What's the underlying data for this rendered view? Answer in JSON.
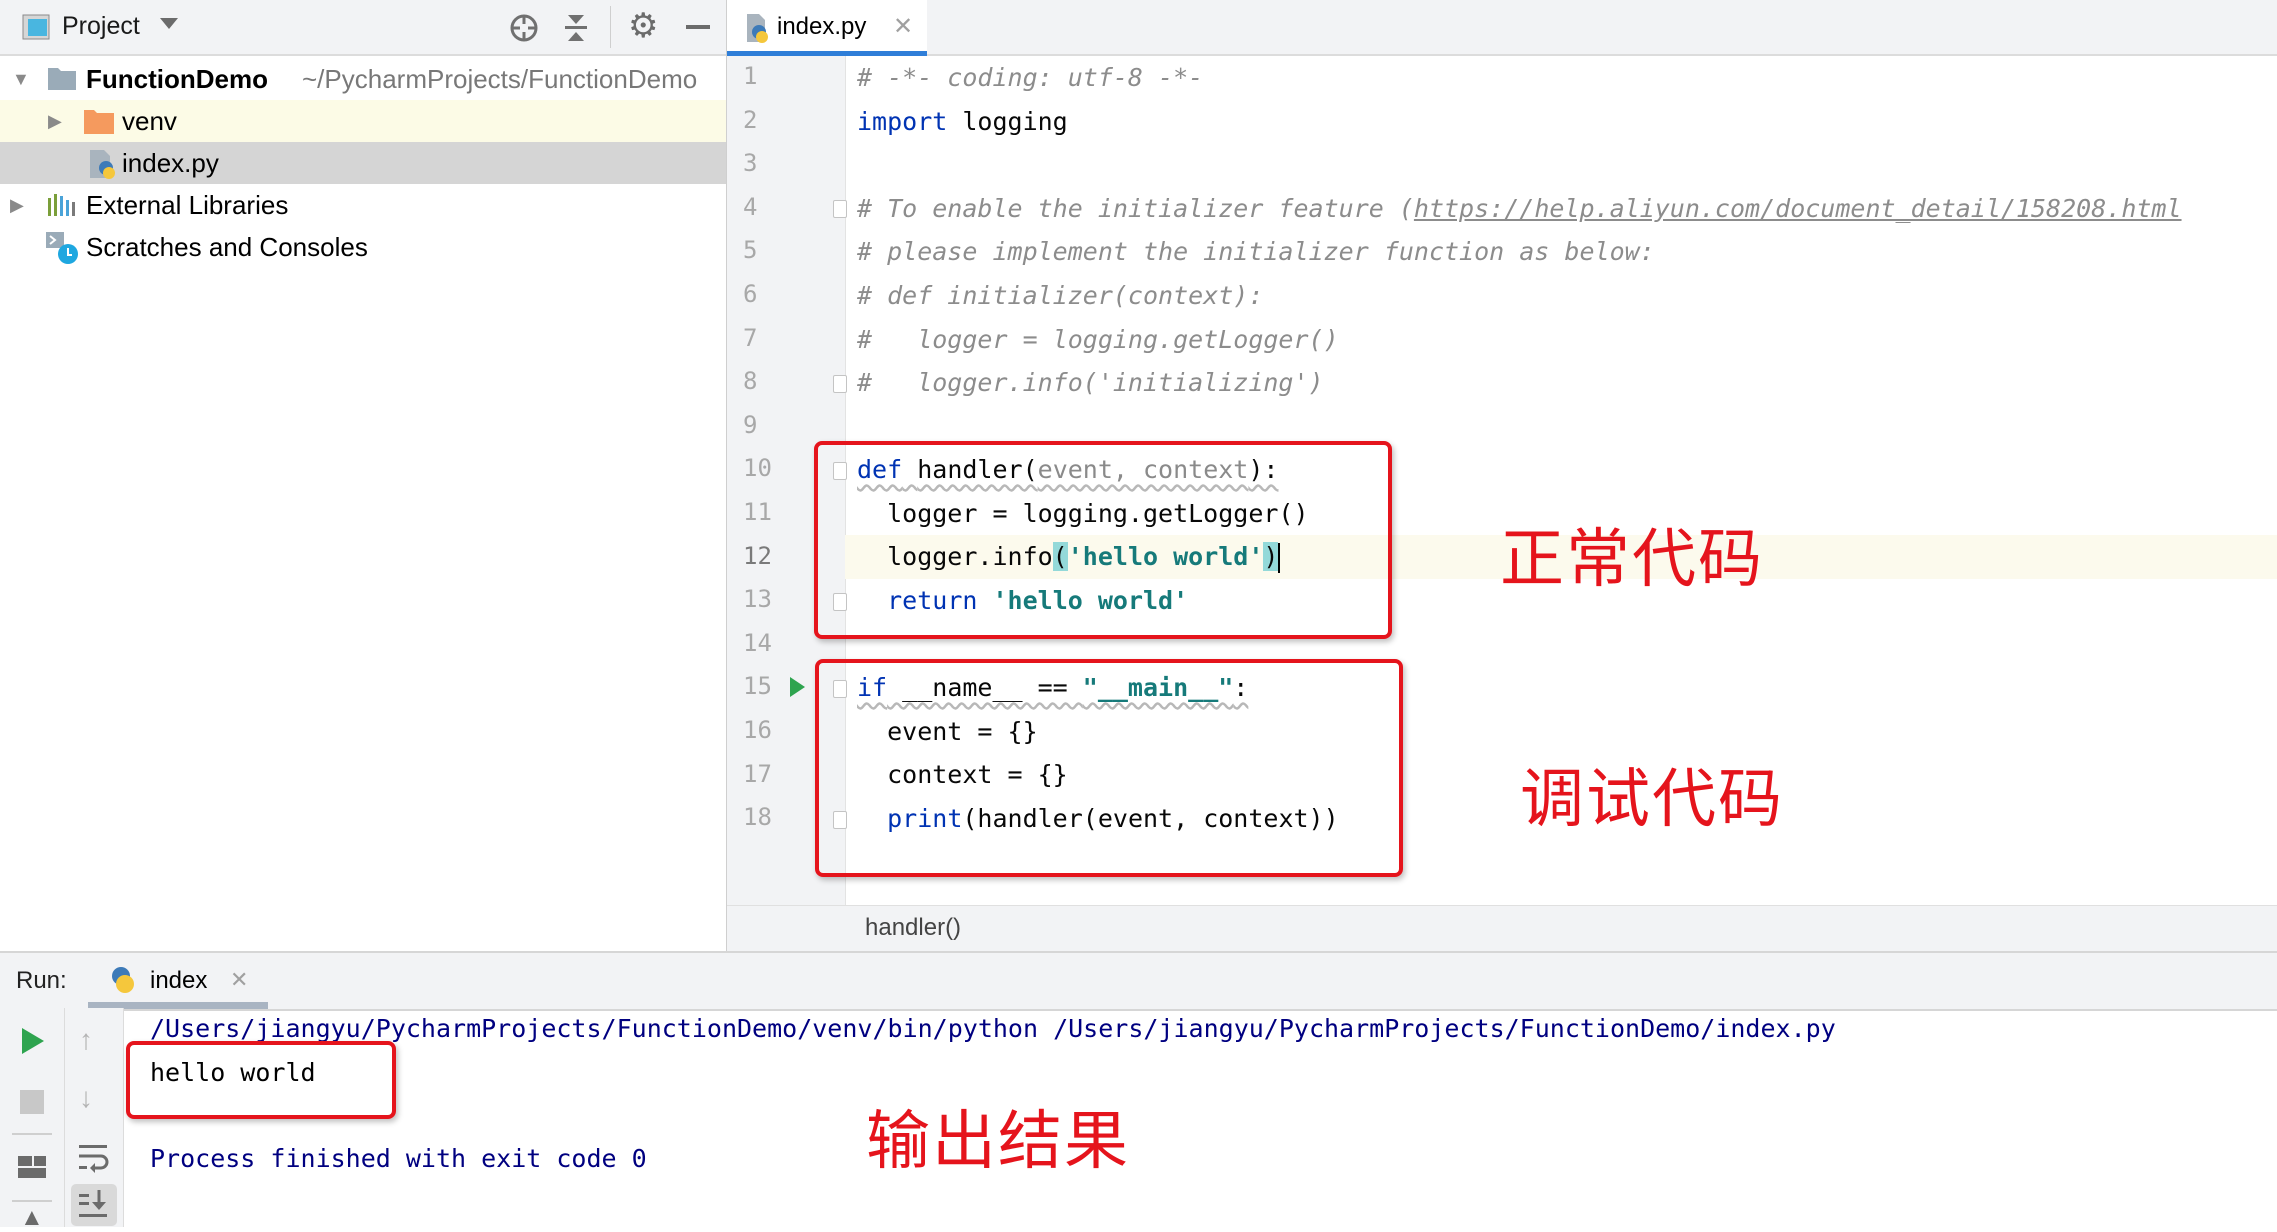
{
  "project_pane": {
    "title": "Project",
    "tree": [
      {
        "label": "FunctionDemo",
        "path": "~/PycharmProjects/FunctionDemo",
        "expanded": true,
        "type": "project-root"
      },
      {
        "label": "venv",
        "expanded": false,
        "type": "folder"
      },
      {
        "label": "index.py",
        "type": "python-file",
        "selected": true
      },
      {
        "label": "External Libraries",
        "expanded": false,
        "type": "libraries"
      },
      {
        "label": "Scratches and Consoles",
        "type": "scratches"
      }
    ]
  },
  "editor": {
    "tab_label": "index.py",
    "line_numbers": [
      "1",
      "2",
      "3",
      "4",
      "5",
      "6",
      "7",
      "8",
      "9",
      "10",
      "11",
      "12",
      "13",
      "14",
      "15",
      "16",
      "17",
      "18"
    ],
    "lines": {
      "l1": "# -*- coding: utf-8 -*-",
      "l2_kw": "import",
      "l2_rest": " logging",
      "l4_pre": "# To enable the initializer feature (",
      "l4_link": "https://help.aliyun.com/document_detail/158208.html",
      "l5": "# please implement the initializer function as below:",
      "l6": "# def initializer(context):",
      "l7": "#   logger = logging.getLogger()",
      "l8": "#   logger.info('initializing')",
      "l10_kw": "def",
      "l10_name": "handler(",
      "l10_params": "event, context",
      "l10_end": "):",
      "l11": "  logger = logging.getLogger()",
      "l12_pre": "  logger.info",
      "l12_open": "(",
      "l12_str": "'hello world'",
      "l12_close": ")",
      "l13_kw": "return",
      "l13_str": "'hello world'",
      "l15_kw": "if",
      "l15_mid": " __name__ == ",
      "l15_str": "\"__main__\"",
      "l15_end": ":",
      "l16": "  event = {}",
      "l17": "  context = {}",
      "l18_kw": "print",
      "l18_rest": "(handler(event, context))"
    },
    "current_line": 12,
    "breadcrumb": "handler()"
  },
  "annotations": {
    "normal_code": "正常代码",
    "debug_code": "调试代码",
    "output_result": "输出结果",
    "highlight_color": "#e5141c"
  },
  "run_panel": {
    "label": "Run:",
    "tab_label": "index",
    "console": {
      "command": "/Users/jiangyu/PycharmProjects/FunctionDemo/venv/bin/python /Users/jiangyu/PycharmProjects/FunctionDemo/index.py",
      "output": "hello world",
      "exit_message": "Process finished with exit code 0"
    }
  }
}
